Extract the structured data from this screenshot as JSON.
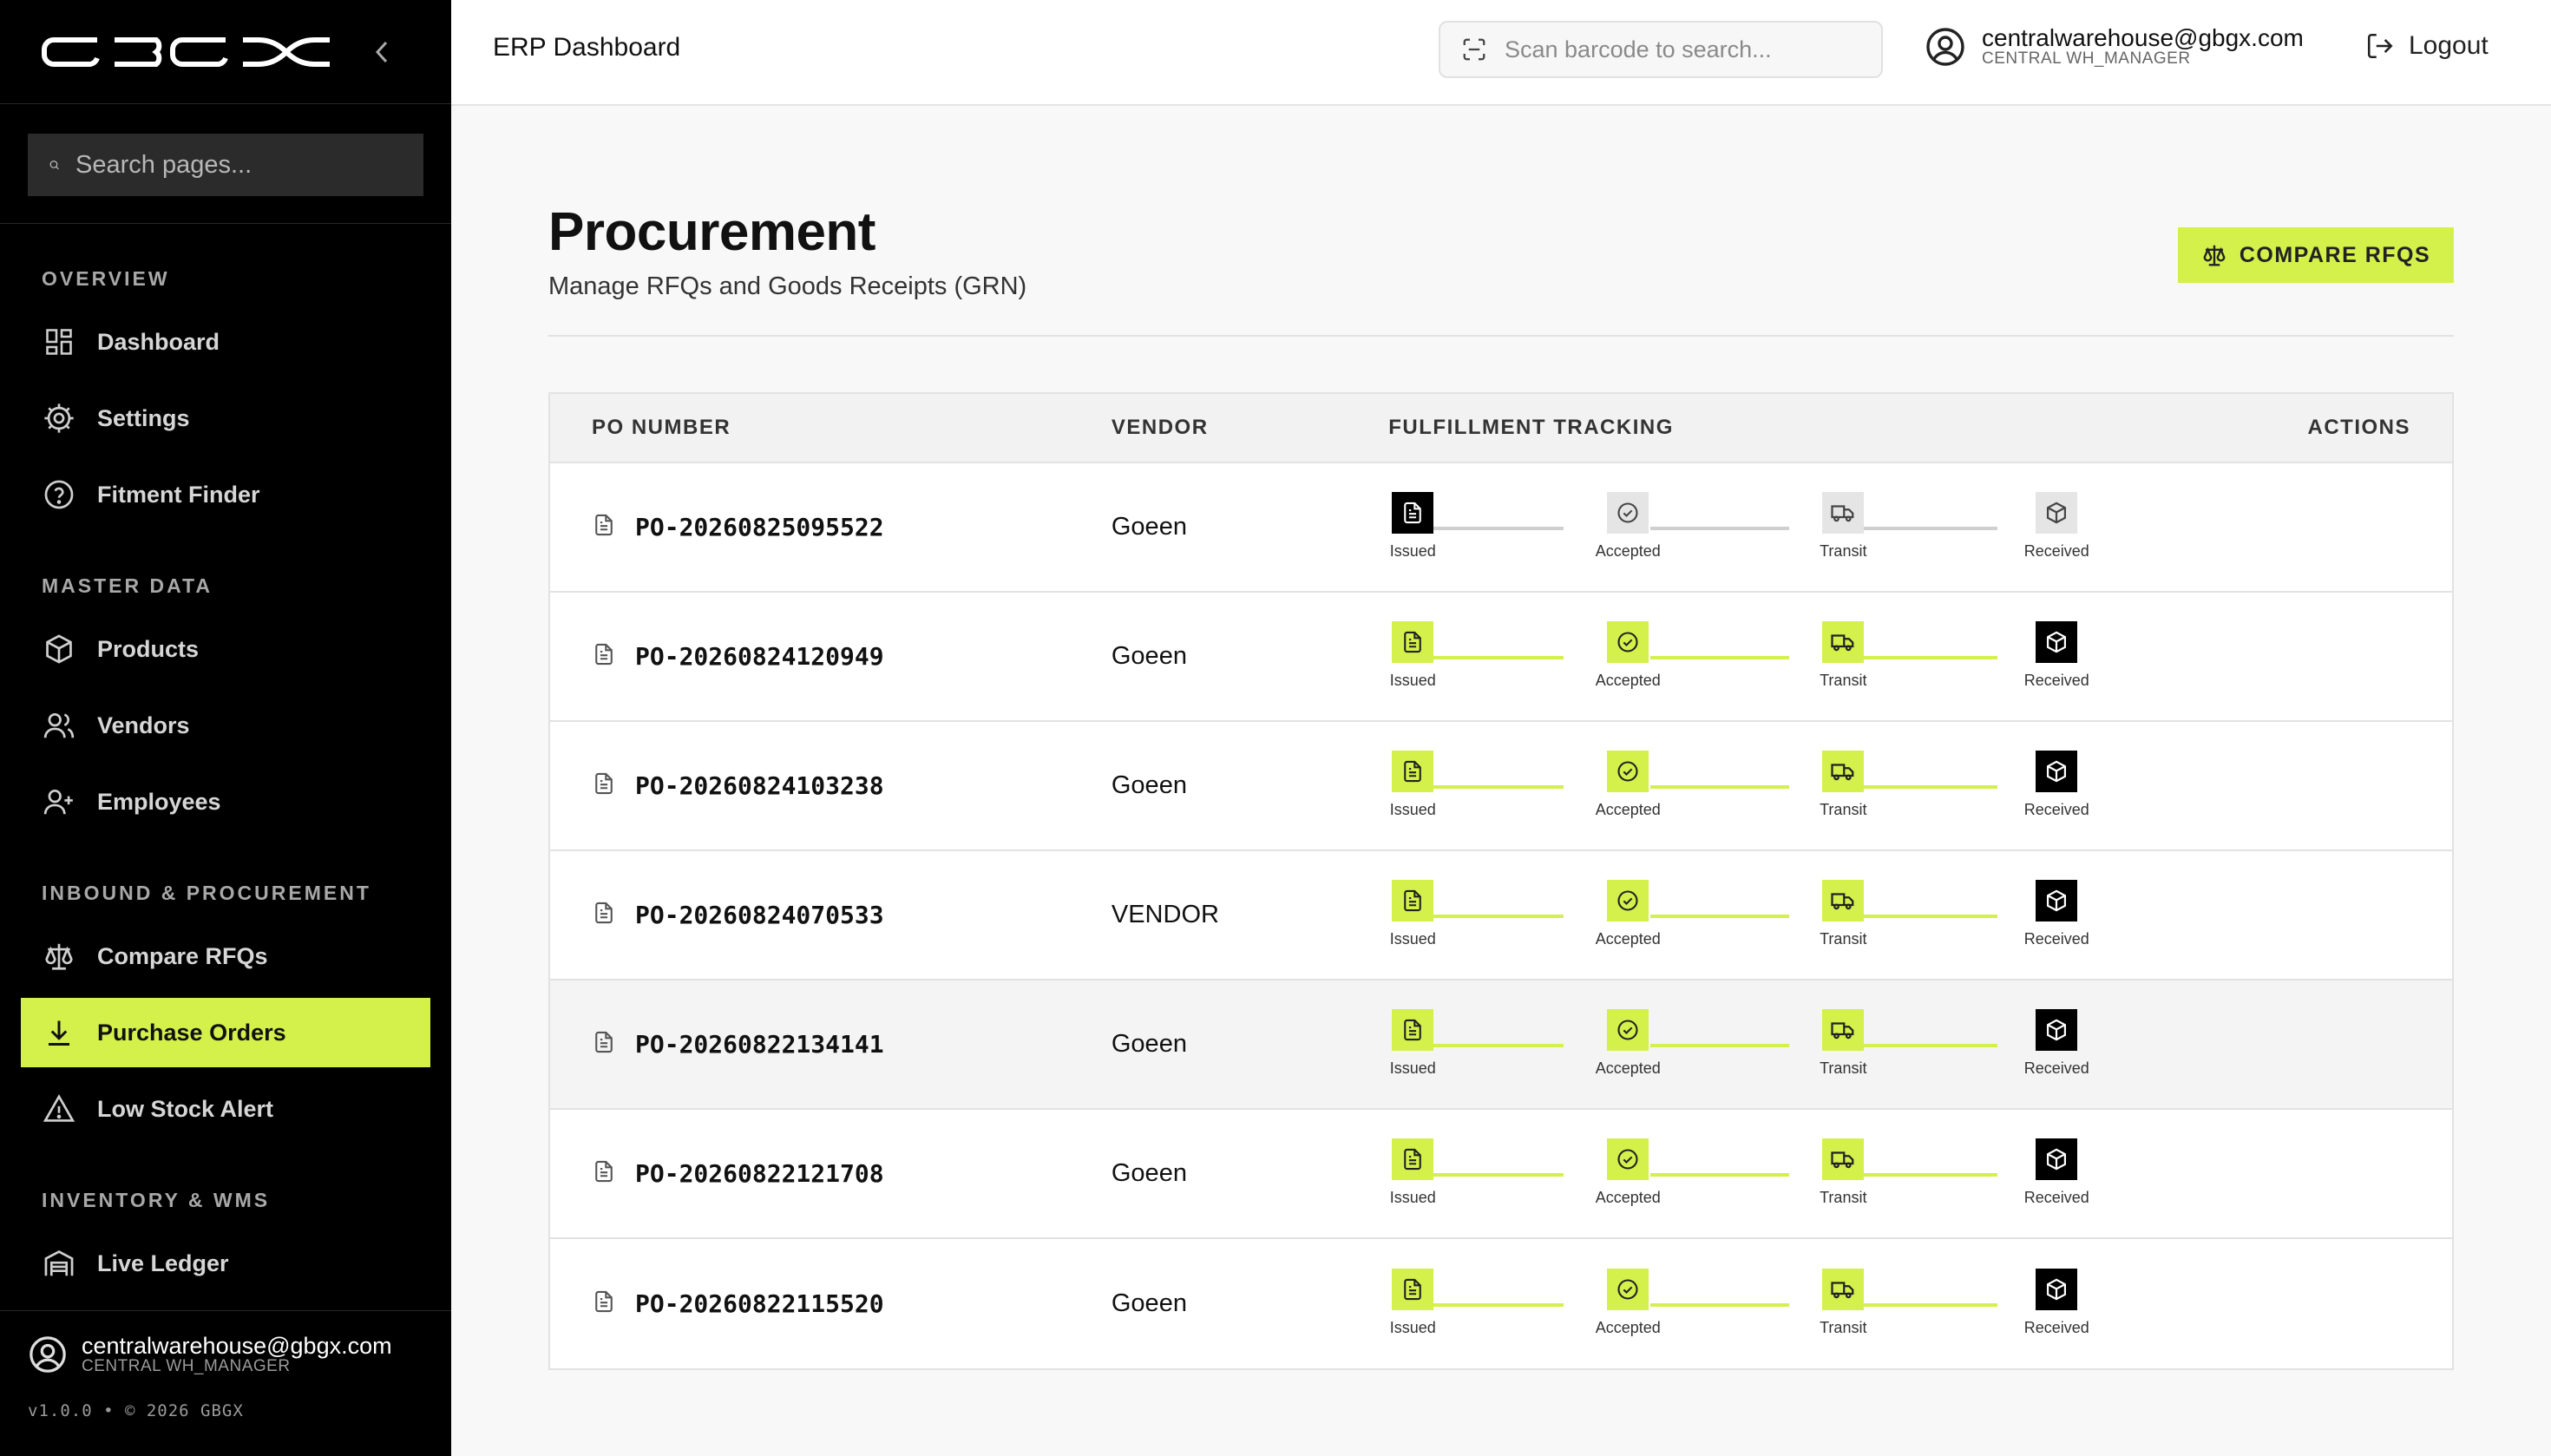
{
  "sidebar": {
    "logo_text": "GBGX",
    "search_placeholder": "Search pages...",
    "sections": [
      {
        "title": "OVERVIEW",
        "items": [
          {
            "label": "Dashboard",
            "icon": "grid-icon"
          },
          {
            "label": "Settings",
            "icon": "gear-icon"
          },
          {
            "label": "Fitment Finder",
            "icon": "help-circle-icon"
          }
        ]
      },
      {
        "title": "MASTER DATA",
        "items": [
          {
            "label": "Products",
            "icon": "box-icon"
          },
          {
            "label": "Vendors",
            "icon": "users-icon"
          },
          {
            "label": "Employees",
            "icon": "user-plus-icon"
          }
        ]
      },
      {
        "title": "INBOUND & PROCUREMENT",
        "items": [
          {
            "label": "Compare RFQs",
            "icon": "scale-icon"
          },
          {
            "label": "Purchase Orders",
            "icon": "download-icon",
            "active": true
          },
          {
            "label": "Low Stock Alert",
            "icon": "alert-triangle-icon"
          }
        ]
      },
      {
        "title": "INVENTORY & WMS",
        "items": [
          {
            "label": "Live Ledger",
            "icon": "warehouse-icon"
          }
        ]
      }
    ],
    "user": {
      "email": "centralwarehouse@gbgx.com",
      "role": "CENTRAL WH_MANAGER"
    },
    "version": "v1.0.0 • © 2026 GBGX"
  },
  "topbar": {
    "page_name": "ERP Dashboard",
    "scan_placeholder": "Scan barcode to search...",
    "user": {
      "email": "centralwarehouse@gbgx.com",
      "role": "CENTRAL WH_MANAGER"
    },
    "logout_label": "Logout"
  },
  "main": {
    "title": "Procurement",
    "subtitle": "Manage RFQs and Goods Receipts (GRN)",
    "compare_button": "COMPARE RFQS",
    "table": {
      "headers": {
        "po": "PO NUMBER",
        "vendor": "VENDOR",
        "tracking": "FULFILLMENT TRACKING",
        "actions": "ACTIONS"
      },
      "step_labels": [
        "Issued",
        "Accepted",
        "Transit",
        "Received"
      ],
      "rows": [
        {
          "po": "PO-20260825095522",
          "vendor": "Goeen",
          "stage": "issued"
        },
        {
          "po": "PO-20260824120949",
          "vendor": "Goeen",
          "stage": "received"
        },
        {
          "po": "PO-20260824103238",
          "vendor": "Goeen",
          "stage": "received"
        },
        {
          "po": "PO-20260824070533",
          "vendor": "VENDOR",
          "stage": "received"
        },
        {
          "po": "PO-20260822134141",
          "vendor": "Goeen",
          "stage": "received",
          "highlighted": true
        },
        {
          "po": "PO-20260822121708",
          "vendor": "Goeen",
          "stage": "received"
        },
        {
          "po": "PO-20260822115520",
          "vendor": "Goeen",
          "stage": "received"
        }
      ]
    }
  },
  "colors": {
    "accent": "#d4f04b",
    "sidebar_bg": "#000000",
    "page_bg": "#f8f8f8"
  }
}
